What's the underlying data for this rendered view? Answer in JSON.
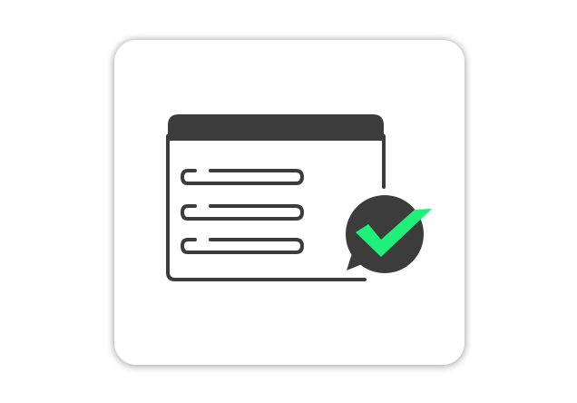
{
  "icon": {
    "name": "form-approved-icon",
    "colors": {
      "tile_background": "#ffffff",
      "outline": "#3c3c3c",
      "check": "#1ef07a"
    }
  }
}
